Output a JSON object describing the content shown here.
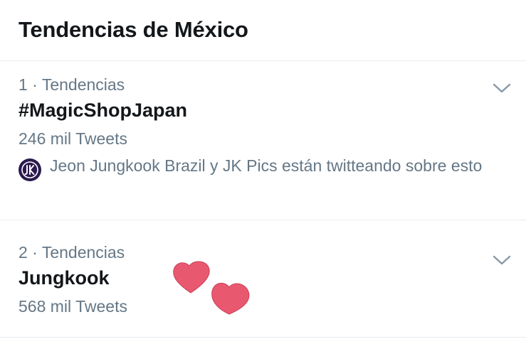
{
  "header": {
    "title": "Tendencias de México"
  },
  "trends": [
    {
      "meta": "1 · Tendencias",
      "name": "#MagicShopJapan",
      "count": "246 mil Tweets",
      "context": "Jeon Jungkook Brazil y JK Pics están twitteando sobre esto",
      "context_avatar_icon": "jk-monogram-avatar"
    },
    {
      "meta": "2 · Tendencias",
      "name": "Jungkook",
      "count": "568 mil Tweets"
    }
  ],
  "icons": {
    "chevron": "chevron-down-icon",
    "decoration": "hearts-icon"
  },
  "colors": {
    "text_primary": "#14171a",
    "text_secondary": "#657786",
    "divider": "#e6ecf0",
    "chevron": "#8899a6",
    "heart": "#e8596f",
    "avatar_bg": "#2b1a4e"
  }
}
